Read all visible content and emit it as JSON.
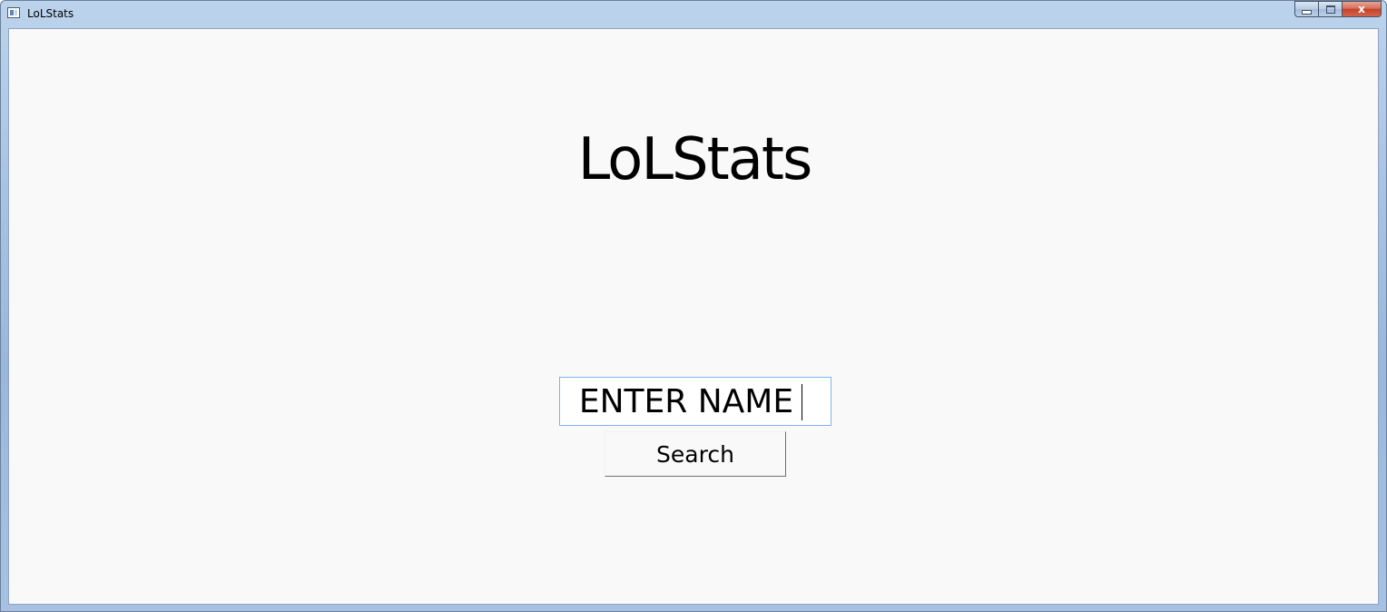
{
  "window": {
    "title": "LoLStats",
    "close_glyph": "x"
  },
  "main": {
    "heading": "LoLStats",
    "name_input_value": "ENTER NAME",
    "search_label": "Search"
  },
  "colors": {
    "titlebar": "#a9c3e3",
    "client_background": "#f9f9f9",
    "input_border": "#7eb4ea",
    "close_button": "#c4412a"
  },
  "icons": [
    "app-window-icon",
    "minimize-icon",
    "maximize-icon",
    "close-icon"
  ]
}
